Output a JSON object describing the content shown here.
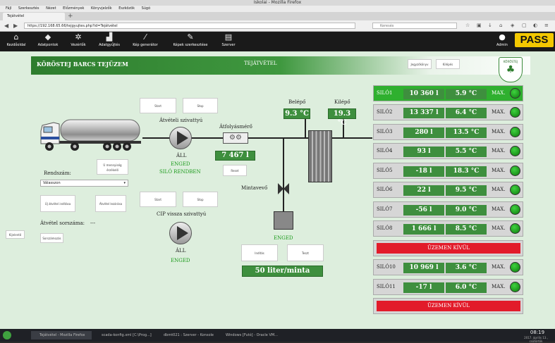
{
  "window": {
    "title": "Iskolai - Mozilla Firefox",
    "tab_title": "Tejátvétel",
    "menu": [
      "Fájl",
      "Szerkesztés",
      "Nézet",
      "Előzmények",
      "Könyvjelzők",
      "Eszközök",
      "Súgó"
    ],
    "url": "https://192.168.65.66/tejgyujtes.php?id=Tejátvétel",
    "search_placeholder": "Keresés"
  },
  "header": {
    "nav": [
      {
        "label": "Kezdőoldal",
        "icon": "home-icon"
      },
      {
        "label": "Adatpontok",
        "icon": "tag-icon"
      },
      {
        "label": "Vezérlők",
        "icon": "gears-icon"
      },
      {
        "label": "Adatgyűjtés",
        "icon": "chart-icon"
      },
      {
        "label": "Kép generátor",
        "icon": "wand-icon"
      },
      {
        "label": "Képek szerkesztése",
        "icon": "edit-icon"
      },
      {
        "label": "Szerver",
        "icon": "server-icon"
      }
    ],
    "admin_label": "Admin",
    "logo_text": "PASS"
  },
  "banner": {
    "title": "KÖRÖSTEJ BARCS TEJÜZEM",
    "subtitle": "TEJÁTVÉTEL",
    "btn1": "Jegyzőkönyv",
    "btn2": "Kilépés",
    "crest_text": "KÖRÖSTEJ"
  },
  "process": {
    "pump1_label": "Átvételi szivattyú",
    "pump1_status1": "ÁLL",
    "pump1_status2": "ENGED",
    "pump1_status3": "SILÓ RENDBEN",
    "pump1_start": "Start",
    "pump1_stop": "Stop",
    "flowmeter_label": "Átfolyásmérő",
    "flowmeter_value": "7 467 l",
    "flowmeter_reset": "Reset",
    "inlet_label": "Belépő",
    "inlet_temp": "9.3 °C",
    "outlet_label": "Kilépő",
    "outlet_temp": "19.3 °C",
    "sampler_label": "Mintavevő",
    "sampler_status": "ENGED",
    "sampler_btn1": "Indítás",
    "sampler_btn2": "Teszt",
    "sample_rate": "50  liter/minta",
    "cip_label": "CIP vissza szivattyú",
    "cip_status1": "ÁLL",
    "cip_status2": "ENGED",
    "cip_start": "Start",
    "cip_stop": "Stop",
    "sensor_label": "Ú mennyiség érzékelő",
    "rendszam_label": "Rendszám:",
    "rendszam_value": "Válasszon",
    "btn_new_reception": "Új átvétel indítása",
    "btn_reception_end": "Átvétel lezárása",
    "sorszam_label": "Átvétel sorszáma:",
    "sorszam_value": "---",
    "btn_reset_sorszam": "Sorszámozás",
    "side_btn": "Kijelentő"
  },
  "silos": [
    {
      "name": "SILÓ1",
      "qty": "10 360  l",
      "temp": "5.9  °C",
      "max": "MAX.",
      "active": true
    },
    {
      "name": "SILÓ2",
      "qty": "13 337  l",
      "temp": "6.4  °C",
      "max": "MAX.",
      "active": false
    },
    {
      "name": "SILÓ3",
      "qty": "280  l",
      "temp": "13.5  °C",
      "max": "MAX.",
      "active": false
    },
    {
      "name": "SILÓ4",
      "qty": "93  l",
      "temp": "5.5  °C",
      "max": "MAX.",
      "active": false
    },
    {
      "name": "SILÓ5",
      "qty": "-18  l",
      "temp": "18.3  °C",
      "max": "MAX.",
      "active": false
    },
    {
      "name": "SILÓ6",
      "qty": "22  l",
      "temp": "9.5  °C",
      "max": "MAX.",
      "active": false
    },
    {
      "name": "SILÓ7",
      "qty": "-56  l",
      "temp": "9.0  °C",
      "max": "MAX.",
      "active": false
    },
    {
      "name": "SILÓ8",
      "qty": "1 666  l",
      "temp": "8.5  °C",
      "max": "MAX.",
      "active": false
    }
  ],
  "silo9_status": "ÜZEMEN KÍVÜL",
  "silos_b": [
    {
      "name": "SILÓ10",
      "qty": "10 969  l",
      "temp": "3.6  °C",
      "max": "MAX."
    },
    {
      "name": "SILÓ11",
      "qty": "-17  l",
      "temp": "6.0  °C",
      "max": "MAX."
    }
  ],
  "silo12_status": "ÜZEMEN KÍVÜL",
  "taskbar": {
    "tasks": [
      "Tejátvétel - Mozilla Firefox",
      "scada-konfig.xml [C:\\Prog...]",
      "dbmt021 : Szerver - Konsole",
      "Windows [Futó] - Oracle VM..."
    ],
    "time": "08:19",
    "date": "2017. április 13., csütörtök"
  },
  "colors": {
    "accent_green": "#3e8f3e",
    "active_silo": "#2fb02f",
    "alarm_red": "#e21b2a",
    "logo_yellow": "#f3c800"
  }
}
